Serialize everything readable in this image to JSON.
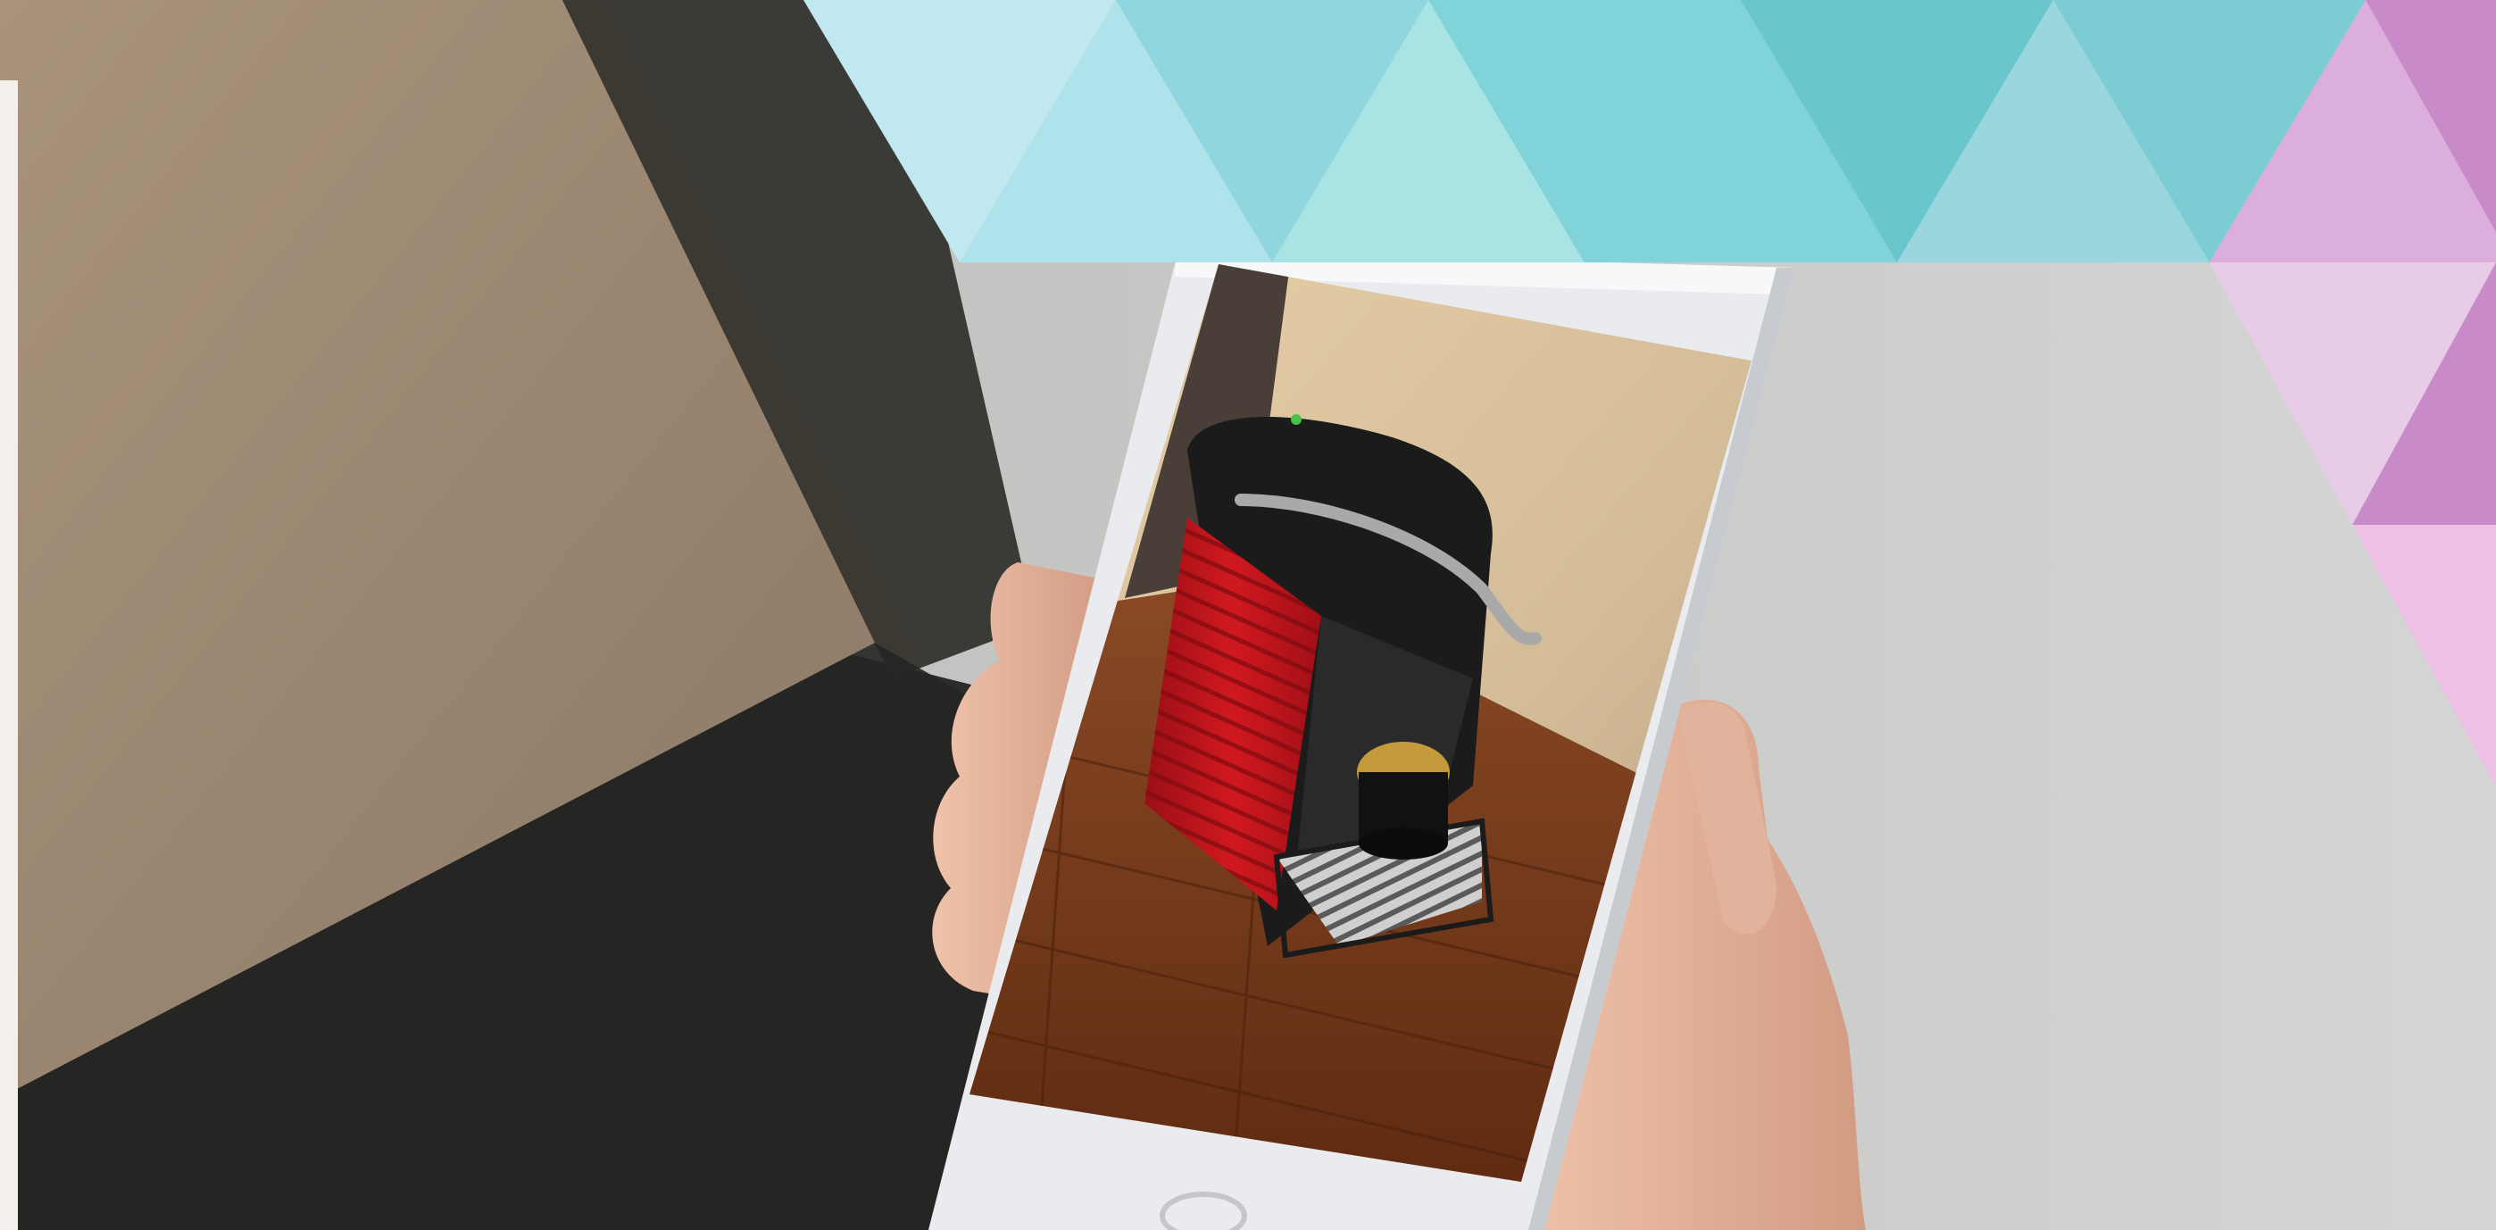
{
  "photo": {
    "subject": "hand-holding-smartphone-ar-view",
    "screen_content": "red-capsule-coffee-machine-on-wood-floor"
  },
  "palette": {
    "wall": "#cfd0cf",
    "table_top": "#a08a74",
    "table_dark": "#2e2e2c",
    "phone_body": "#e9ebee",
    "skin": "#e2b39c",
    "machine_red": "#c3141d",
    "machine_black": "#1b1b1b",
    "floor": "#7a3d1c",
    "screen_wall": "#d9c4a0",
    "teal": [
      "#c1e8f1",
      "#aee3ec",
      "#8fd6de",
      "#7fd3d9",
      "#68c6cc",
      "#9ad6de",
      "#a8e4e4"
    ],
    "pink": [
      "#dcaedb",
      "#c88ac8",
      "#e8cce7",
      "#efc0e6"
    ]
  }
}
